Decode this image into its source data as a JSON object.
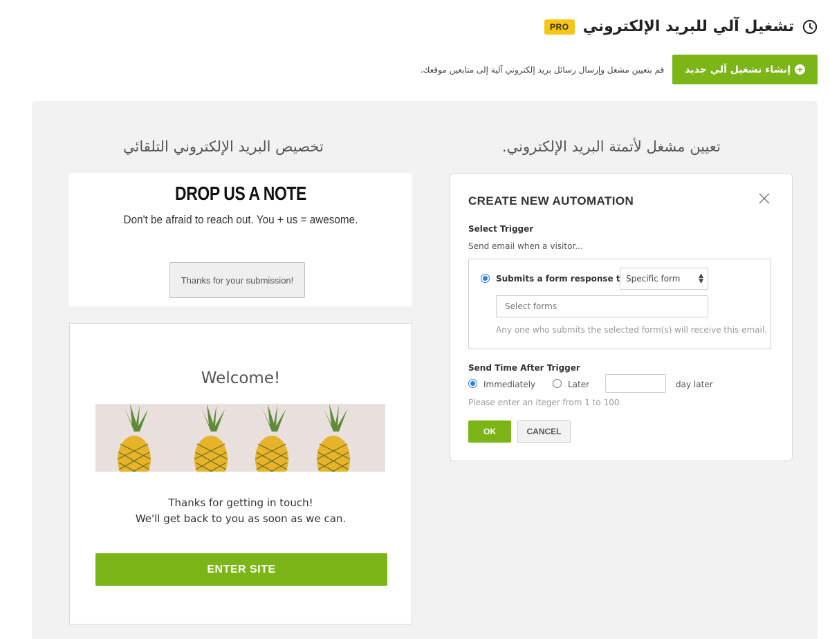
{
  "header": {
    "title": "تشغيل آلي للبريد الإلكتروني",
    "badge": "PRO",
    "icon": "clock-icon",
    "create_button": "إنشاء تشغيل آلي جديد",
    "description": "قم بتعيين مشغل وإرسال رسائل بريد إلكتروني آلية إلى متابعين موقعك."
  },
  "columns": {
    "left_title": "تخصيص البريد الإلكتروني التلقائي",
    "right_title": "تعيين مشغل لأتمتة البريد الإلكتروني."
  },
  "note_card": {
    "title": "DROP US A NOTE",
    "subtitle": "Don't be afraid to reach out. You + us = awesome.",
    "button": "Thanks for your submission!"
  },
  "welcome_card": {
    "title": "Welcome!",
    "line1": "Thanks for getting in touch!",
    "line2": "We'll get back to you as soon as we can.",
    "button": "ENTER SITE"
  },
  "modal": {
    "title": "CREATE NEW AUTOMATION",
    "select_trigger_label": "Select Trigger",
    "trigger_intro": "Send email when a visitor...",
    "trigger_option": "Submits a form response to",
    "form_scope_selected": "Specific form",
    "forms_placeholder": "Select forms",
    "forms_hint": "Any one who submits the selected form(s) will receive this email.",
    "send_time_label": "Send Time After Trigger",
    "immediately_label": "Immediately",
    "later_label": "Later",
    "day_later_label": "day later",
    "integer_hint": "Please enter an iteger  from 1 to 100.",
    "ok_button": "OK",
    "cancel_button": "CANCEL",
    "send_time_selected": "Immediately"
  },
  "colors": {
    "accent": "#7cb518",
    "badge": "#f5c518",
    "radio": "#2a7de1"
  }
}
